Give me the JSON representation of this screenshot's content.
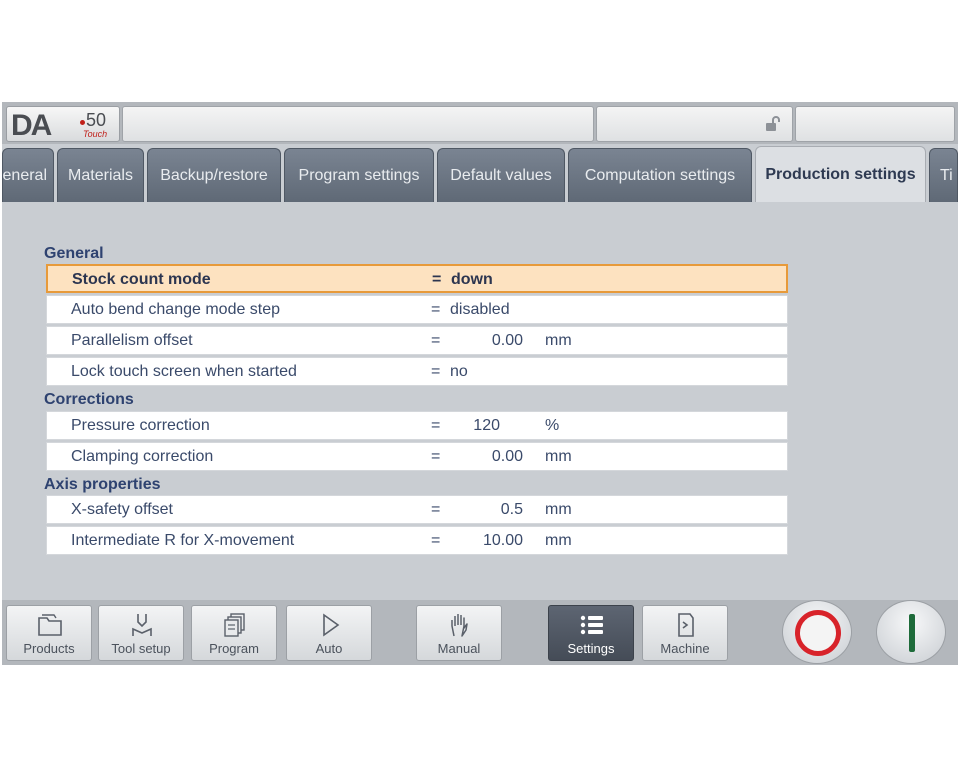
{
  "logo": {
    "brand": "DA",
    "model": "50",
    "variant": "Touch"
  },
  "icons": {
    "lock": "unlocked-padlock-icon"
  },
  "tabs": [
    {
      "label": "eneral",
      "active": false
    },
    {
      "label": "Materials",
      "active": false
    },
    {
      "label": "Backup/restore",
      "active": false
    },
    {
      "label": "Program settings",
      "active": false
    },
    {
      "label": "Default values",
      "active": false
    },
    {
      "label": "Computation settings",
      "active": false
    },
    {
      "label": "Production settings",
      "active": true
    },
    {
      "label": "Ti",
      "active": false
    }
  ],
  "sections": {
    "general": {
      "title": "General",
      "rows": [
        {
          "label": "Stock count mode",
          "eq": "=",
          "value": "down",
          "unit": ""
        },
        {
          "label": "Auto bend change mode step",
          "eq": "=",
          "value": "disabled",
          "unit": ""
        },
        {
          "label": "Parallelism offset",
          "eq": "=",
          "value": "0.00",
          "unit": "mm"
        },
        {
          "label": "Lock touch screen when started",
          "eq": "=",
          "value": "no",
          "unit": ""
        }
      ]
    },
    "corrections": {
      "title": "Corrections",
      "rows": [
        {
          "label": "Pressure correction",
          "eq": "=",
          "value": "120",
          "unit": "%"
        },
        {
          "label": "Clamping correction",
          "eq": "=",
          "value": "0.00",
          "unit": "mm"
        }
      ]
    },
    "axis": {
      "title": "Axis properties",
      "rows": [
        {
          "label": "X-safety offset",
          "eq": "=",
          "value": "0.5",
          "unit": "mm"
        },
        {
          "label": "Intermediate R for X-movement",
          "eq": "=",
          "value": "10.00",
          "unit": "mm"
        }
      ]
    }
  },
  "nav": [
    {
      "label": "Products",
      "icon": "folder-icon",
      "active": false
    },
    {
      "label": "Tool setup",
      "icon": "tool-setup-icon",
      "active": false
    },
    {
      "label": "Program",
      "icon": "program-pages-icon",
      "active": false
    },
    {
      "label": "Auto",
      "icon": "play-icon",
      "active": false
    },
    {
      "label": "Manual",
      "icon": "hand-icon",
      "active": false
    },
    {
      "label": "Settings",
      "icon": "settings-list-icon",
      "active": true
    },
    {
      "label": "Machine",
      "icon": "machine-icon",
      "active": false
    }
  ],
  "colors": {
    "accent_selected": "#e79a3a",
    "section_heading": "#2e4270",
    "stop": "#d8232a",
    "start": "#1e6b3a"
  }
}
